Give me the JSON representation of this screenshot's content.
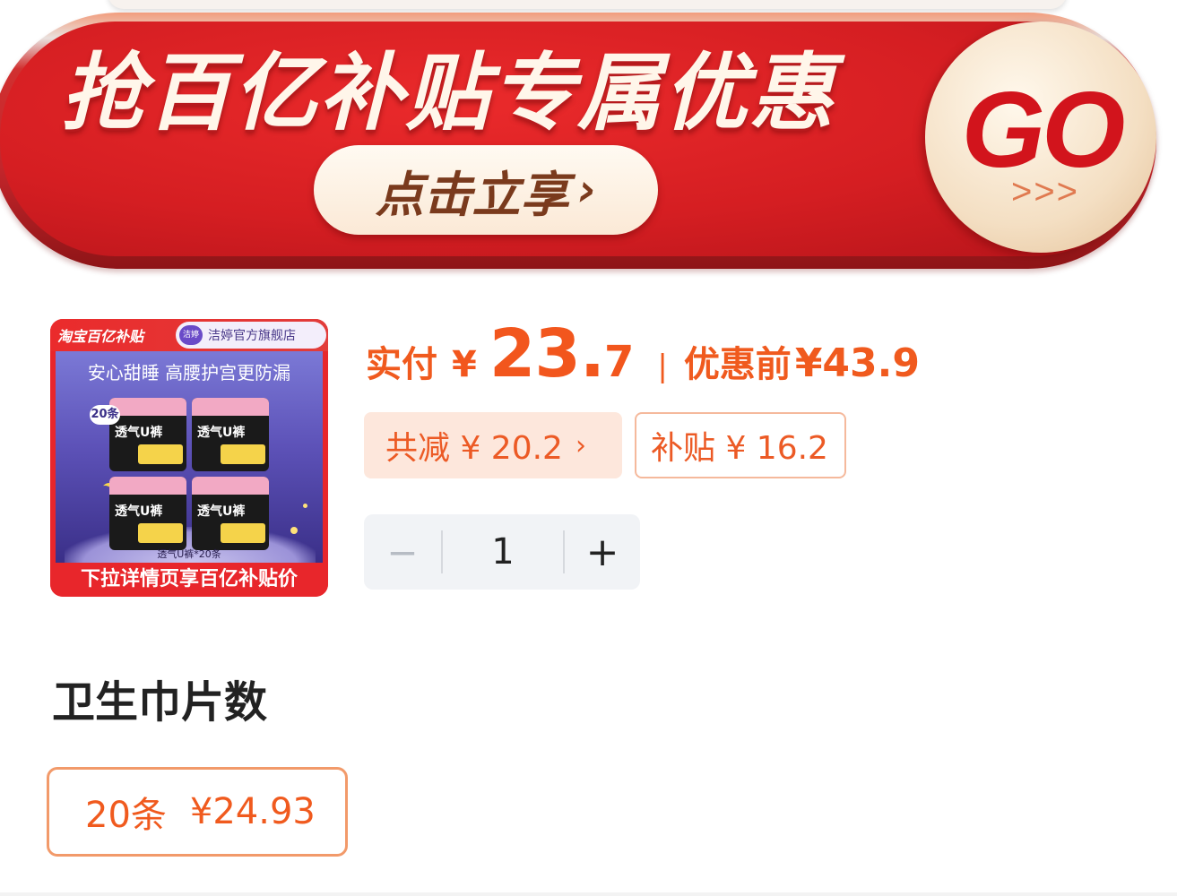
{
  "banner": {
    "title": "抢百亿补贴专属优惠",
    "cta_label": "点击立享",
    "cta_chevron": "›",
    "go_label": "GO",
    "go_arrows": ">>>"
  },
  "product": {
    "image": {
      "brand_tag": "淘宝百亿补贴",
      "store_name": "洁婷官方旗舰店",
      "store_logo": "洁婷",
      "slogan": "安心甜睡 高腰护宫更防漏",
      "count_badge": "20条",
      "pack_label": "透气U裤",
      "caption": "透气U裤*20条",
      "bottom_text": "下拉详情页享百亿补贴价"
    }
  },
  "price": {
    "pay_label": "实付",
    "currency": "¥",
    "pay_int": "23.",
    "pay_dec": "7",
    "separator": "|",
    "before_label": "优惠前",
    "before_value": "¥43.9",
    "discount_chip": "共减 ¥ 20.2",
    "discount_chevron": "›",
    "subsidy_chip": "补贴 ¥ 16.2"
  },
  "quantity": {
    "minus": "−",
    "value": "1",
    "plus": "+"
  },
  "spec": {
    "title": "卫生巾片数",
    "option_label": "20条",
    "option_price": "¥24.93"
  },
  "colors": {
    "accent": "#f05a1e",
    "banner_red": "#d51e22",
    "chip_bg": "#fde7dc"
  }
}
